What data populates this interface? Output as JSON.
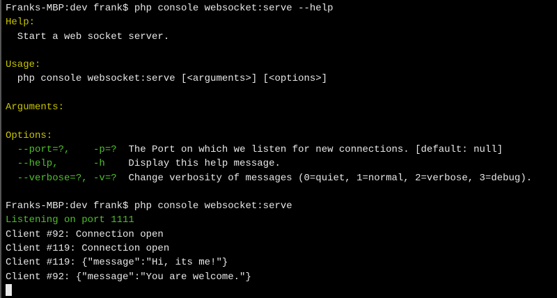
{
  "colors": {
    "background": "#000000",
    "text": "#e8e8e8",
    "heading": "#c8c400",
    "option": "#4fbf2b"
  },
  "prompt": "Franks-MBP:dev frank$ ",
  "command1": "php console websocket:serve --help",
  "help_heading": "Help:",
  "help_text": "  Start a web socket server.",
  "usage_heading": "Usage:",
  "usage_text": "  php console websocket:serve [<arguments>] [<options>]",
  "arguments_heading": "Arguments:",
  "options_heading": "Options:",
  "options": [
    {
      "name": "  --port=?,    -p=?",
      "desc": "  The Port on which we listen for new connections. [default: null]"
    },
    {
      "name": "  --help,      -h",
      "desc": "    Display this help message."
    },
    {
      "name": "  --verbose=?, -v=?",
      "desc": "  Change verbosity of messages (0=quiet, 1=normal, 2=verbose, 3=debug)."
    }
  ],
  "command2": "php console websocket:serve",
  "listening": "Listening on port 1111",
  "log": [
    "Client #92: Connection open",
    "Client #119: Connection open",
    "Client #119: {\"message\":\"Hi, its me!\"}",
    "Client #92: {\"message\":\"You are welcome.\"}"
  ]
}
